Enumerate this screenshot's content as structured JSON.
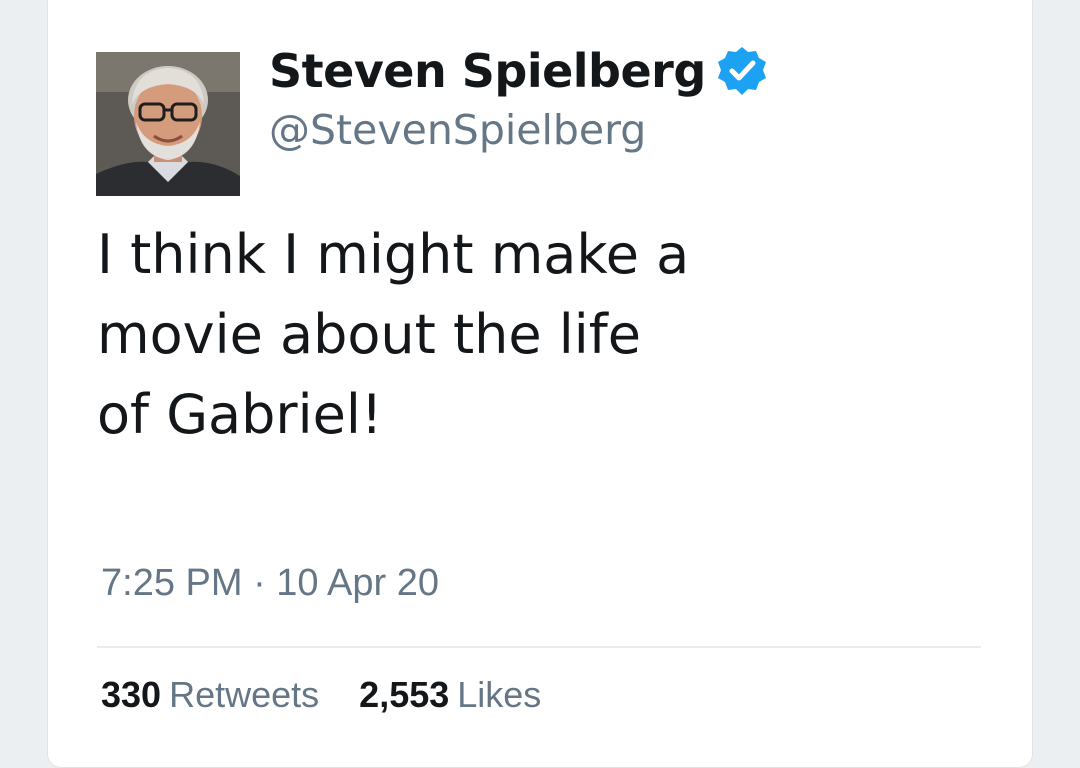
{
  "tweet": {
    "author": {
      "display_name": "Steven Spielberg",
      "handle": "@StevenSpielberg",
      "verified": true,
      "verified_icon": "verified-badge-icon"
    },
    "text_lines": [
      "I think I might make a",
      "movie about the life",
      "of Gabriel!"
    ],
    "timestamp": "7:25 PM · 10 Apr 20",
    "stats": {
      "retweets_count": "330",
      "retweets_label": "Retweets",
      "likes_count": "2,553",
      "likes_label": "Likes"
    }
  },
  "colors": {
    "verified_blue": "#1da1f2",
    "text_primary": "#14171a",
    "text_secondary": "#657786"
  }
}
